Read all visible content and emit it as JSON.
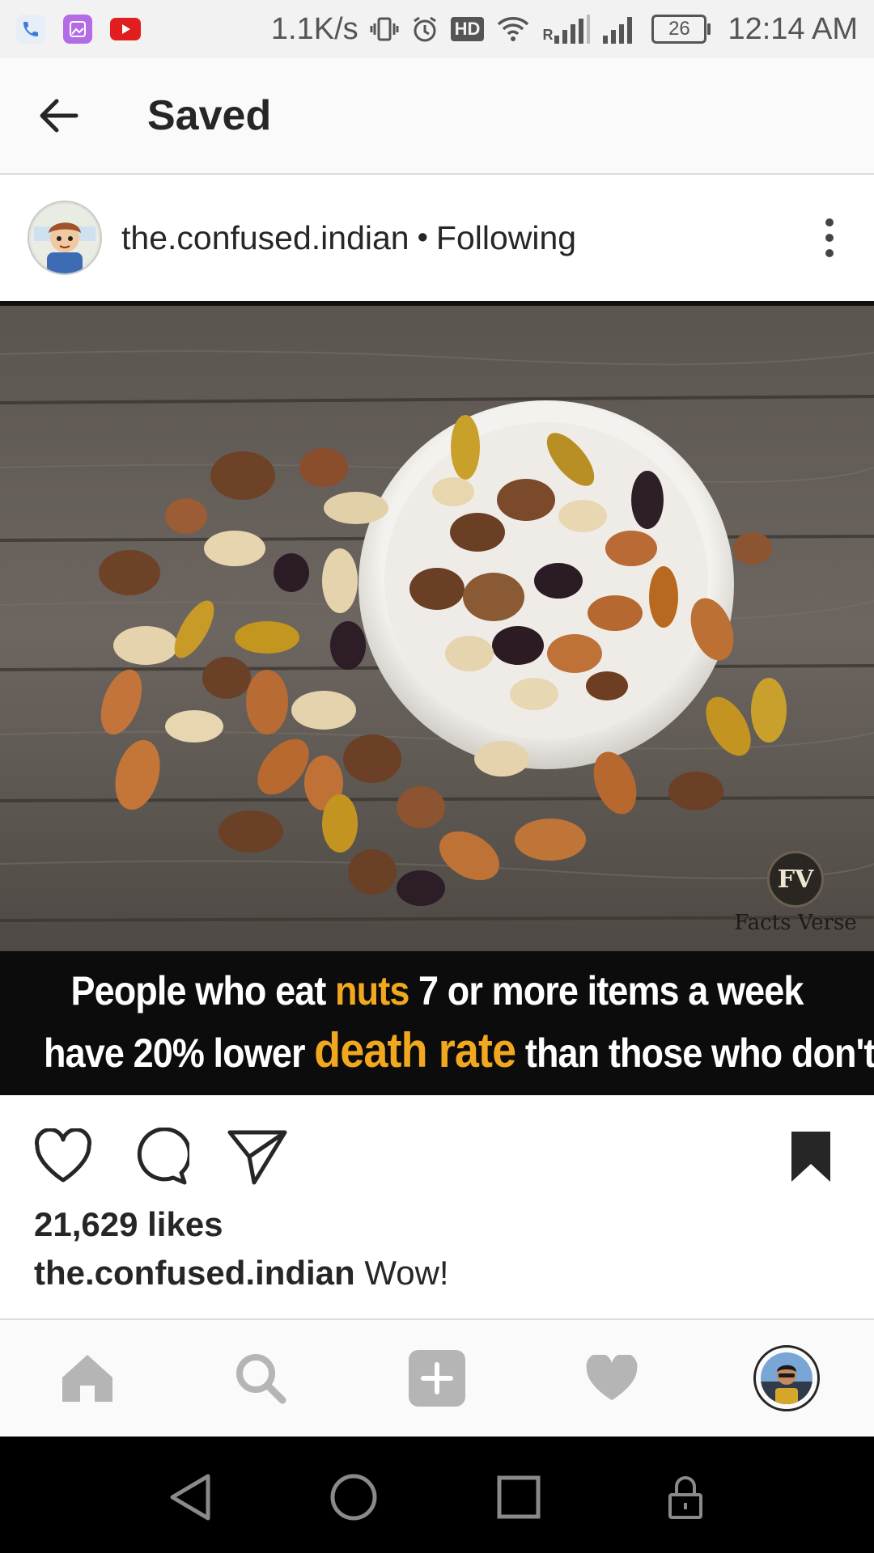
{
  "status_bar": {
    "net_speed": "1.1K/s",
    "hd_badge": "HD",
    "roaming_label": "R",
    "battery": "26",
    "time": "12:14 AM",
    "icons": [
      "phone-icon",
      "gallery-icon",
      "youtube-icon",
      "vibrate-icon",
      "alarm-icon",
      "hd-icon",
      "wifi-icon",
      "signal-icon",
      "signal-icon",
      "battery-icon"
    ]
  },
  "header": {
    "title": "Saved",
    "back_icon": "back-arrow-icon"
  },
  "post": {
    "username": "the.confused.indian",
    "separator": "•",
    "follow_status": "Following",
    "more_icon": "more-vertical-icon",
    "image": {
      "description_icon": "mixed-nuts-bowl-photo",
      "watermark_badge": "FV",
      "watermark_text": "Facts Verse",
      "overlay_line1": {
        "a": "People who eat ",
        "b": "nuts",
        "c": " 7 or more items a week"
      },
      "overlay_line2": {
        "a": "have 20% lower ",
        "b": "death rate",
        "c": " than those who don't."
      },
      "highlight_color": "#f2a81e"
    },
    "likes": "21,629 likes",
    "caption_user": "the.confused.indian",
    "caption_text": "Wow!",
    "actions": [
      "heart-icon",
      "comment-icon",
      "share-icon",
      "bookmark-icon"
    ]
  },
  "bottom_nav": {
    "items": [
      "home-icon",
      "search-icon",
      "add-post-icon",
      "activity-heart-icon",
      "profile-avatar"
    ]
  },
  "system_nav": {
    "items": [
      "back-triangle-icon",
      "home-circle-icon",
      "recents-square-icon",
      "lock-icon"
    ]
  }
}
